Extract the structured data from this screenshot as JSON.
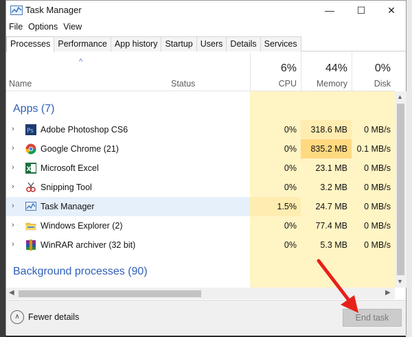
{
  "window": {
    "title": "Task Manager"
  },
  "menu": [
    "File",
    "Options",
    "View"
  ],
  "tabs": [
    "Processes",
    "Performance",
    "App history",
    "Startup",
    "Users",
    "Details",
    "Services"
  ],
  "columns": {
    "name": "Name",
    "status": "Status",
    "cpu": {
      "pct": "6%",
      "label": "CPU"
    },
    "memory": {
      "pct": "44%",
      "label": "Memory"
    },
    "disk": {
      "pct": "0%",
      "label": "Disk"
    }
  },
  "groups": {
    "apps": "Apps (7)",
    "background": "Background processes (90)"
  },
  "apps": [
    {
      "name": "Adobe Photoshop CS6",
      "cpu": "0%",
      "memory": "318.6 MB",
      "disk": "0 MB/s",
      "icon": "photoshop-icon"
    },
    {
      "name": "Google Chrome (21)",
      "cpu": "0%",
      "memory": "835.2 MB",
      "disk": "0.1 MB/s",
      "icon": "chrome-icon"
    },
    {
      "name": "Microsoft Excel",
      "cpu": "0%",
      "memory": "23.1 MB",
      "disk": "0 MB/s",
      "icon": "excel-icon"
    },
    {
      "name": "Snipping Tool",
      "cpu": "0%",
      "memory": "3.2 MB",
      "disk": "0 MB/s",
      "icon": "snipping-tool-icon"
    },
    {
      "name": "Task Manager",
      "cpu": "1.5%",
      "memory": "24.7 MB",
      "disk": "0 MB/s",
      "icon": "task-manager-icon"
    },
    {
      "name": "Windows Explorer (2)",
      "cpu": "0%",
      "memory": "77.4 MB",
      "disk": "0 MB/s",
      "icon": "explorer-icon"
    },
    {
      "name": "WinRAR archiver (32 bit)",
      "cpu": "0%",
      "memory": "5.3 MB",
      "disk": "0 MB/s",
      "icon": "winrar-icon"
    }
  ],
  "footer": {
    "fewer_details": "Fewer details",
    "end_task": "End task"
  },
  "colors": {
    "heat_light": "#fff4c4",
    "heat_mid": "#ffecb0",
    "heat_strong": "#ffd980",
    "accent": "#2f5fb8",
    "arrow": "#e8201a"
  }
}
